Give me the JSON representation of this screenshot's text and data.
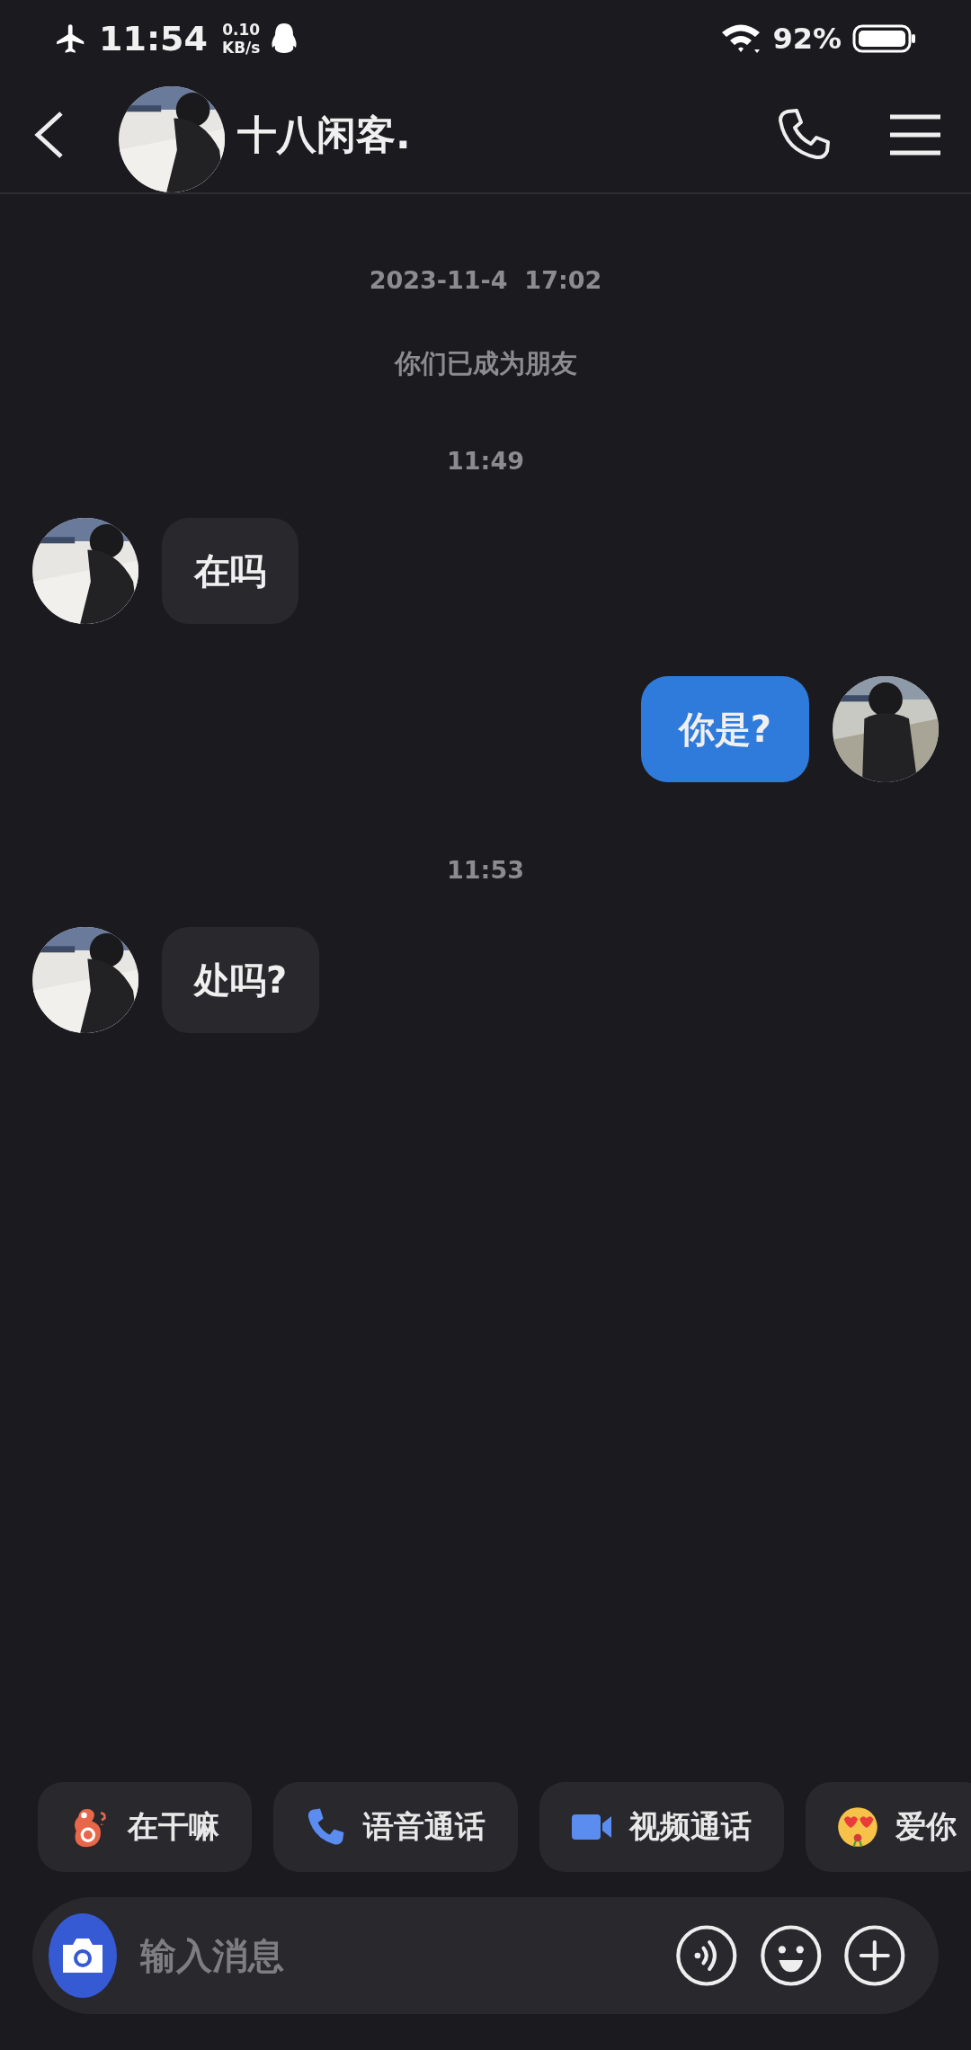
{
  "status_bar": {
    "time": "11:54",
    "speed_value": "0.10",
    "speed_unit": "KB/s",
    "battery": "92%"
  },
  "header": {
    "title": "十八闲客."
  },
  "messages": [
    {
      "kind": "time",
      "text": "2023-11-4  17:02"
    },
    {
      "kind": "system",
      "text": "你们已成为朋友"
    },
    {
      "kind": "time",
      "text": "11:49"
    },
    {
      "kind": "received",
      "text": "在吗"
    },
    {
      "kind": "sent",
      "text": "你是?"
    },
    {
      "kind": "time",
      "text": "11:53"
    },
    {
      "kind": "received",
      "text": "处吗?"
    }
  ],
  "quick_actions": [
    {
      "kind": "greeting",
      "label": "在干嘛"
    },
    {
      "kind": "voice",
      "label": "语音通话"
    },
    {
      "kind": "video",
      "label": "视频通话"
    },
    {
      "kind": "love",
      "label": "爱你"
    }
  ],
  "composer": {
    "placeholder": "输入消息"
  }
}
